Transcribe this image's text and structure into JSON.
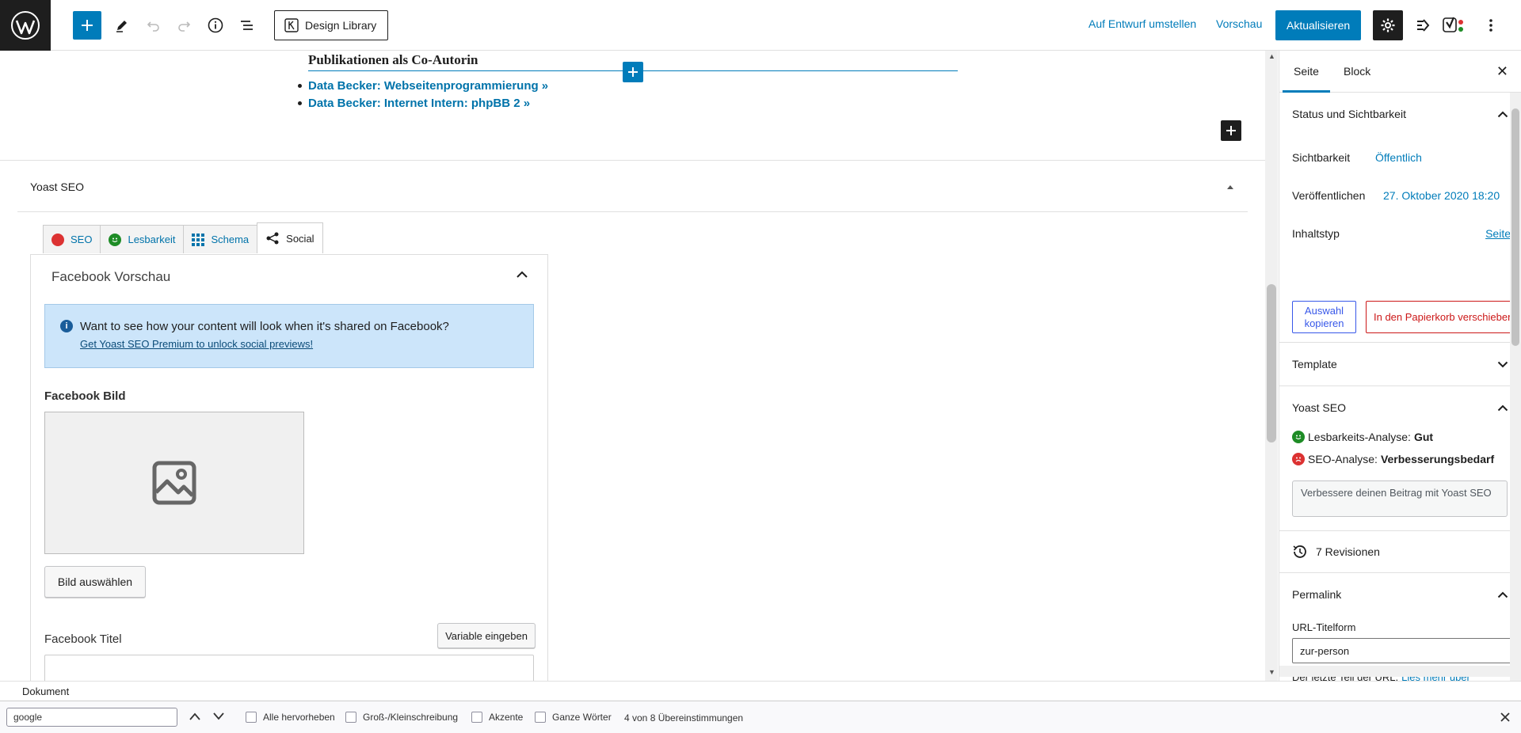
{
  "topbar": {
    "design_library": "Design Library",
    "switch_draft": "Auf Entwurf umstellen",
    "preview": "Vorschau",
    "update": "Aktualisieren"
  },
  "content": {
    "publications_heading": "Publikationen als Co-Autorin",
    "publications": [
      "Data Becker: Webseitenprogrammierung »",
      "Data Becker: Internet Intern: phpBB 2 »"
    ]
  },
  "yoast_meta": {
    "title": "Yoast SEO",
    "tabs": [
      "SEO",
      "Lesbarkeit",
      "Schema",
      "Social"
    ],
    "fb_preview_title": "Facebook Vorschau",
    "info_text": "Want to see how your content will look when it's shared on Facebook?",
    "info_link": "Get Yoast SEO Premium to unlock social previews!",
    "fb_image_label": "Facebook Bild",
    "choose_image": "Bild auswählen",
    "fb_title_label": "Facebook Titel",
    "insert_variable": "Variable eingeben"
  },
  "sidebar": {
    "tab_page": "Seite",
    "tab_block": "Block",
    "status_title": "Status und Sichtbarkeit",
    "visibility_label": "Sichtbarkeit",
    "visibility_value": "Öffentlich",
    "published_label": "Veröffentlichen",
    "published_value": "27. Oktober 2020 18:20",
    "content_type_label": "Inhaltstyp",
    "content_type_value": "Seite",
    "copy_selection": "Auswahl kopieren",
    "move_trash": "In den Papierkorb verschieben",
    "template_title": "Template",
    "yoast_title": "Yoast SEO",
    "readability_label": "Lesbarkeits-Analyse:",
    "readability_value": "Gut",
    "seo_label": "SEO-Analyse:",
    "seo_value": "Verbesserungsbedarf",
    "improve_button": "Verbessere deinen Beitrag mit Yoast SEO",
    "revisions": "7 Revisionen",
    "permalink_title": "Permalink",
    "url_slug_label": "URL-Titelform",
    "url_slug_value": "zur-person",
    "url_help": "Der letzte Teil der URL.",
    "url_help_link": "Lies mehr über"
  },
  "footer": {
    "breadcrumb": "Dokument"
  },
  "findbar": {
    "query": "google",
    "highlight_all": "Alle hervorheben",
    "match_case": "Groß-/Kleinschreibung",
    "accents": "Akzente",
    "whole_words": "Ganze Wörter",
    "status": "4 von 8 Übereinstimmungen"
  },
  "colors": {
    "accent": "#007cba",
    "good": "#1e8c26",
    "bad": "#dc3232"
  }
}
